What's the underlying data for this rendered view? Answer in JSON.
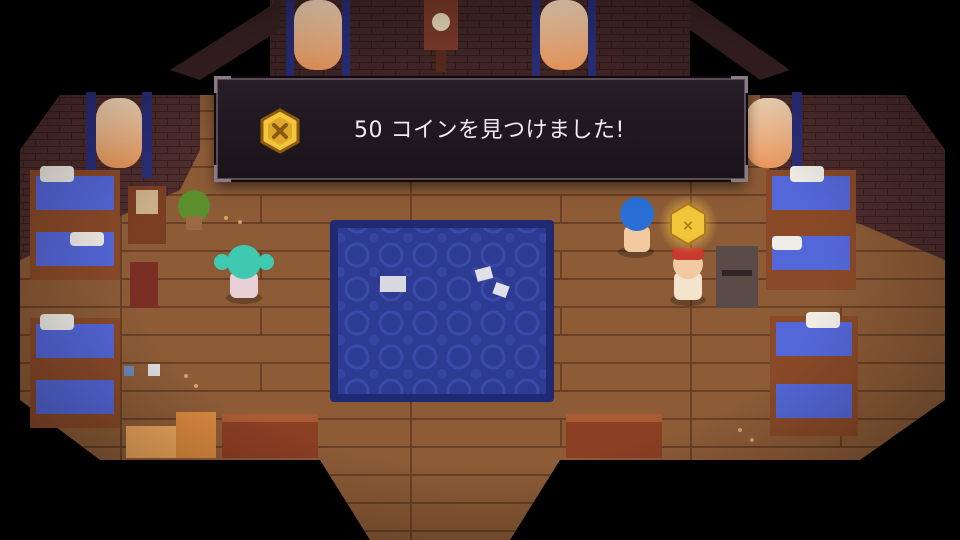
{
  "notification": {
    "message": "50 コインを見つけました!",
    "icon": "gold-coin-icon"
  },
  "scene": {
    "location": "bunk room",
    "colors": {
      "floor": "#8a5a36",
      "rug": "#2c3a8f",
      "wall": "#4b2c2c",
      "bed_blanket": "#5467d8",
      "coin_gold": "#f2c53a"
    }
  }
}
